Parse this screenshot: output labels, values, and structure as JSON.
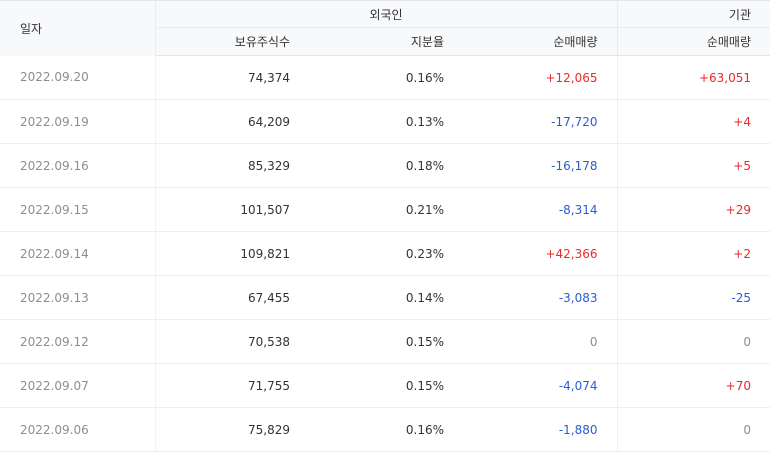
{
  "header": {
    "date": "일자",
    "foreign_group": "외국인",
    "institution_group": "기관",
    "holdings": "보유주식수",
    "ratio": "지분율",
    "foreign_net": "순매매량",
    "institution_net": "순매매량"
  },
  "rows": [
    {
      "date": "2022.09.20",
      "holdings": "74,374",
      "ratio": "0.16%",
      "foreign_net": "+12,065",
      "foreign_dir": "up",
      "inst_net": "+63,051",
      "inst_dir": "up"
    },
    {
      "date": "2022.09.19",
      "holdings": "64,209",
      "ratio": "0.13%",
      "foreign_net": "-17,720",
      "foreign_dir": "down",
      "inst_net": "+4",
      "inst_dir": "up"
    },
    {
      "date": "2022.09.16",
      "holdings": "85,329",
      "ratio": "0.18%",
      "foreign_net": "-16,178",
      "foreign_dir": "down",
      "inst_net": "+5",
      "inst_dir": "up"
    },
    {
      "date": "2022.09.15",
      "holdings": "101,507",
      "ratio": "0.21%",
      "foreign_net": "-8,314",
      "foreign_dir": "down",
      "inst_net": "+29",
      "inst_dir": "up"
    },
    {
      "date": "2022.09.14",
      "holdings": "109,821",
      "ratio": "0.23%",
      "foreign_net": "+42,366",
      "foreign_dir": "up",
      "inst_net": "+2",
      "inst_dir": "up"
    },
    {
      "date": "2022.09.13",
      "holdings": "67,455",
      "ratio": "0.14%",
      "foreign_net": "-3,083",
      "foreign_dir": "down",
      "inst_net": "-25",
      "inst_dir": "down"
    },
    {
      "date": "2022.09.12",
      "holdings": "70,538",
      "ratio": "0.15%",
      "foreign_net": "0",
      "foreign_dir": "zero",
      "inst_net": "0",
      "inst_dir": "zero"
    },
    {
      "date": "2022.09.07",
      "holdings": "71,755",
      "ratio": "0.15%",
      "foreign_net": "-4,074",
      "foreign_dir": "down",
      "inst_net": "+70",
      "inst_dir": "up"
    },
    {
      "date": "2022.09.06",
      "holdings": "75,829",
      "ratio": "0.16%",
      "foreign_net": "-1,880",
      "foreign_dir": "down",
      "inst_net": "0",
      "inst_dir": "zero"
    }
  ],
  "colors": {
    "up": "#e72a2a",
    "down": "#2a5ed0",
    "zero": "#8a8e95",
    "header_bg": "#f8f9fb"
  }
}
